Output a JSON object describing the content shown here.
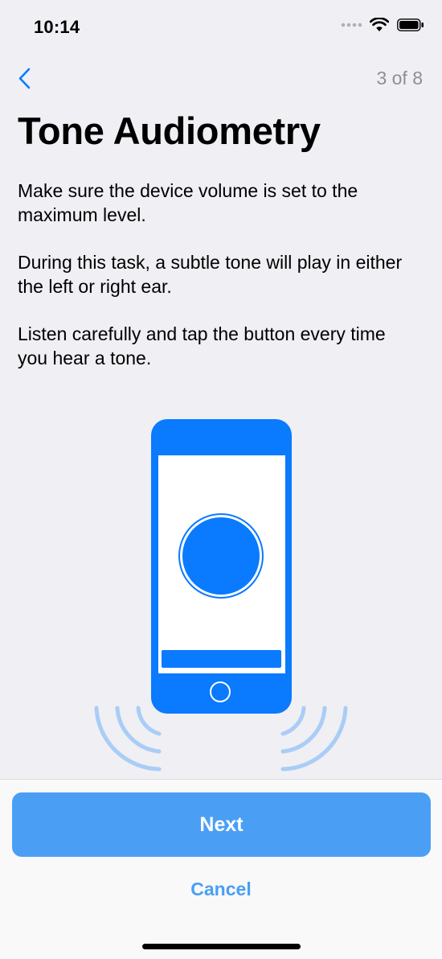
{
  "status_bar": {
    "time": "10:14",
    "icons": [
      "signal-dots-icon",
      "wifi-icon",
      "battery-icon"
    ]
  },
  "nav": {
    "back_icon": "chevron-left-icon",
    "step_counter": "3 of 8"
  },
  "page": {
    "title": "Tone Audiometry",
    "paragraphs": [
      "Make sure the device volume is set to the maximum level.",
      "During this task, a subtle tone will play in either the left or right ear.",
      "Listen carefully and tap the button every time you hear a tone."
    ]
  },
  "illustration": {
    "description_icon": "phone-with-tap-button-icon",
    "phone_color": "#0a7aff",
    "wave_color": "#a9cdf6"
  },
  "footer": {
    "next_label": "Next",
    "cancel_label": "Cancel"
  },
  "colors": {
    "accent": "#4a9ff5",
    "background": "#efeff4",
    "secondary_text": "#8e8e93"
  }
}
